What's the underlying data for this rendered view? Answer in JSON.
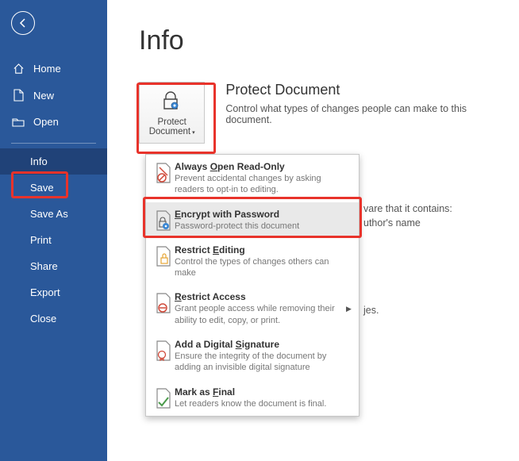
{
  "sidebar": {
    "items": [
      {
        "label": "Home"
      },
      {
        "label": "New"
      },
      {
        "label": "Open"
      },
      {
        "label": "Info"
      },
      {
        "label": "Save"
      },
      {
        "label": "Save As"
      },
      {
        "label": "Print"
      },
      {
        "label": "Share"
      },
      {
        "label": "Export"
      },
      {
        "label": "Close"
      }
    ]
  },
  "page": {
    "title": "Info"
  },
  "protect": {
    "button_line1": "Protect",
    "button_line2": "Document",
    "heading": "Protect Document",
    "subtitle": "Control what types of changes people can make to this document."
  },
  "dropdown": [
    {
      "title_pre": "Always ",
      "title_u": "O",
      "title_post": "pen Read-Only",
      "desc": "Prevent accidental changes by asking readers to opt-in to editing."
    },
    {
      "title_pre": "",
      "title_u": "E",
      "title_post": "ncrypt with Password",
      "desc": "Password-protect this document"
    },
    {
      "title_pre": "Restrict ",
      "title_u": "E",
      "title_post": "diting",
      "desc": "Control the types of changes others can make"
    },
    {
      "title_pre": "",
      "title_u": "R",
      "title_post": "estrict Access",
      "desc": "Grant people access while removing their ability to edit, copy, or print."
    },
    {
      "title_pre": "Add a Digital ",
      "title_u": "S",
      "title_post": "ignature",
      "desc": "Ensure the integrity of the document by adding an invisible digital signature"
    },
    {
      "title_pre": "Mark as ",
      "title_u": "F",
      "title_post": "inal",
      "desc": "Let readers know the document is final."
    }
  ],
  "bg": {
    "f1": "vare that it contains:",
    "f2": "uthor's name",
    "f3": "jes."
  }
}
